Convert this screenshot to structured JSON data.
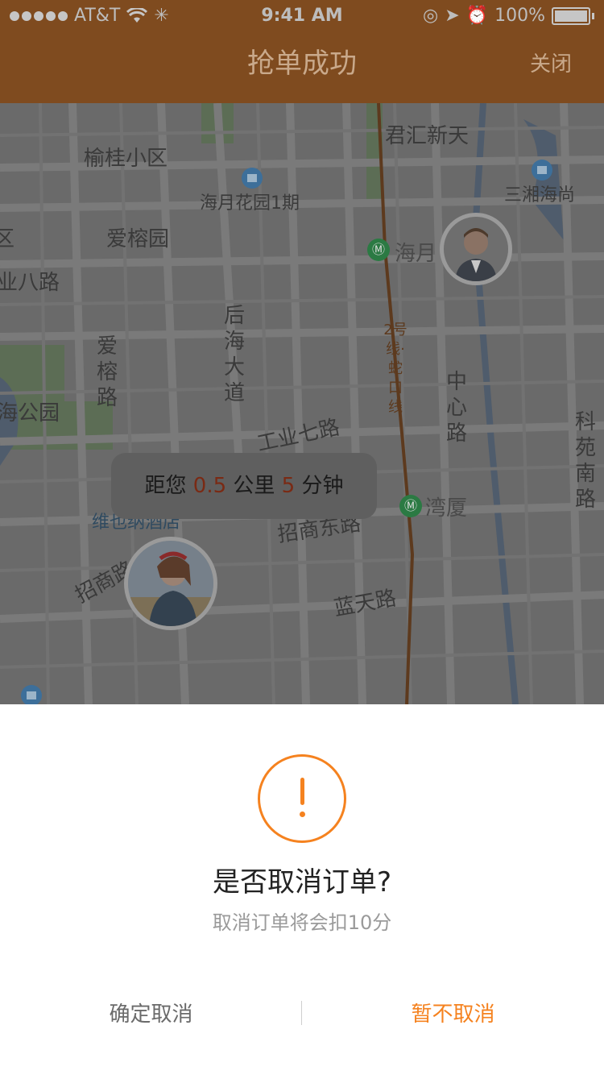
{
  "status_bar": {
    "carrier": "AT&T",
    "time": "9:41 AM",
    "battery": "100%"
  },
  "nav": {
    "title": "抢单成功",
    "close_label": "关闭"
  },
  "map": {
    "labels": {
      "yugui": "榆桂小区",
      "junhui": "君汇新天",
      "haiyue_garden": "海月花园1期",
      "sanxiang": "三湘海尚",
      "airong_garden": "爱榕园",
      "ye_ba_road": "业八路",
      "haiyue_station": "海月",
      "airong_road": "爱榕路",
      "houhai_avenue": "后海大道",
      "line2": "2号线·蛇口线",
      "zhongxin_road": "中心路",
      "kejinan_road": "科苑南路",
      "haigong_park": "海公园",
      "gongye7_road": "工业七路",
      "wanxia_station": "湾厦",
      "zhaoshang_east_road": "招商东路",
      "weidu_hotel": "维也纳酒店",
      "zhaoshang_road": "招商路",
      "lantian_road": "蓝天路",
      "left_edge": "区"
    },
    "metro_icon": "metro-icon"
  },
  "distance_tip": {
    "prefix": "距您 ",
    "distance": "0.5",
    "unit1": " 公里 ",
    "minutes": "5",
    "unit2": " 分钟"
  },
  "dialog": {
    "icon": "exclamation-icon",
    "title": "是否取消订单?",
    "message": "取消订单将会扣10分",
    "confirm_label": "确定取消",
    "keep_label": "暂不取消"
  },
  "colors": {
    "accent": "#f5821f",
    "topbar_dimmed": "#7f4b1f",
    "map_dimmed": "#6a6a6a"
  }
}
